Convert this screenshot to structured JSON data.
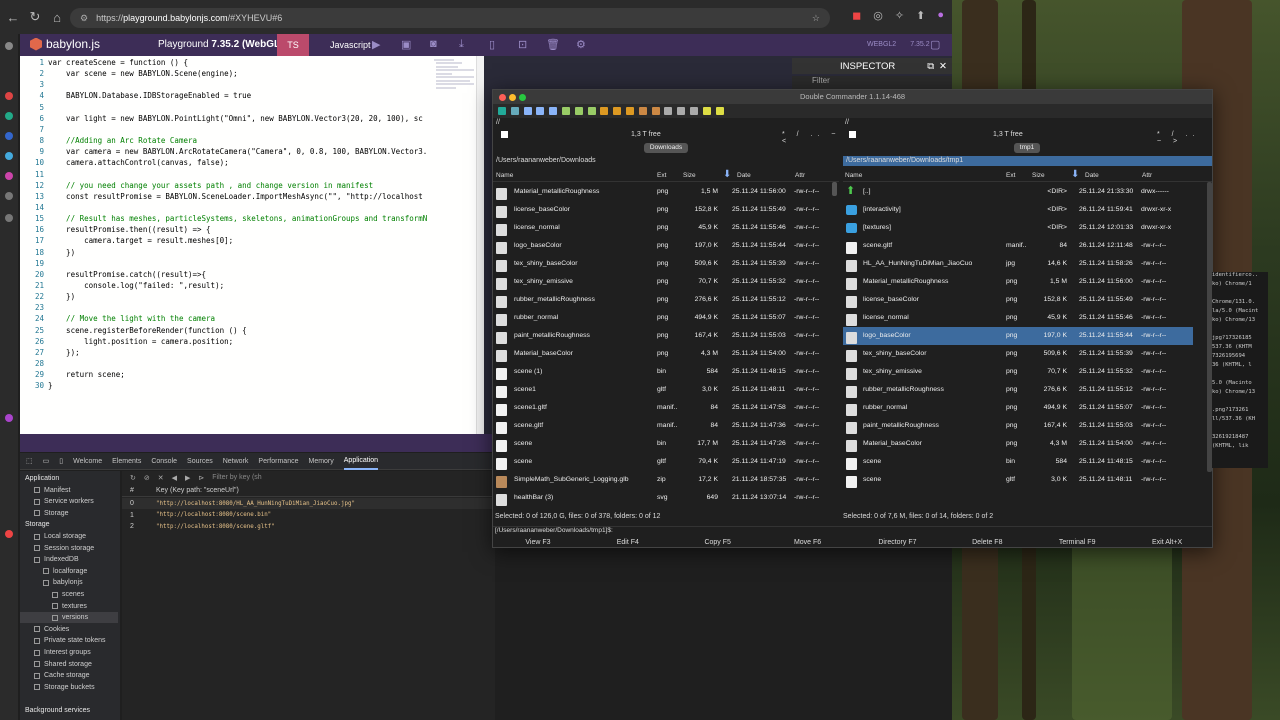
{
  "browser": {
    "url_host": "playground.babylonjs.com",
    "url_rest": "/#XYHEVU#6",
    "url_prefix": "https://"
  },
  "babylon": {
    "logo_text": "babylon.js",
    "playground_label": "Playground",
    "version_label": "7.35.2 (WebGL2)",
    "ts_label": "TS",
    "js_label": "Javascript",
    "webgl_label": "WEBGL2",
    "version_short": "7.35.2"
  },
  "code_lines": [
    {
      "n": "1",
      "t": "var createScene = function () {"
    },
    {
      "n": "2",
      "t": "    var scene = new BABYLON.Scene(engine);"
    },
    {
      "n": "3",
      "t": ""
    },
    {
      "n": "4",
      "t": "    BABYLON.Database.IDBStorageEnabled = true"
    },
    {
      "n": "5",
      "t": ""
    },
    {
      "n": "6",
      "t": "    var light = new BABYLON.PointLight(\"Omni\", new BABYLON.Vector3(20, 20, 100), sc"
    },
    {
      "n": "7",
      "t": ""
    },
    {
      "n": "8",
      "t": "    //Adding an Arc Rotate Camera"
    },
    {
      "n": "9",
      "t": "    var camera = new BABYLON.ArcRotateCamera(\"Camera\", 0, 0.8, 100, BABYLON.Vector3."
    },
    {
      "n": "10",
      "t": "    camera.attachControl(canvas, false);"
    },
    {
      "n": "11",
      "t": ""
    },
    {
      "n": "12",
      "t": "    // you need change your assets path , and change version in manifest"
    },
    {
      "n": "13",
      "t": "    const resultPromise = BABYLON.SceneLoader.ImportMeshAsync(\"\", \"http://localhost"
    },
    {
      "n": "14",
      "t": ""
    },
    {
      "n": "15",
      "t": "    // Result has meshes, particleSystems, skeletons, animationGroups and transformN"
    },
    {
      "n": "16",
      "t": "    resultPromise.then((result) => {"
    },
    {
      "n": "17",
      "t": "        camera.target = result.meshes[0];"
    },
    {
      "n": "18",
      "t": "    })"
    },
    {
      "n": "19",
      "t": ""
    },
    {
      "n": "20",
      "t": "    resultPromise.catch((result)=>{"
    },
    {
      "n": "21",
      "t": "        console.log(\"failed: \",result);"
    },
    {
      "n": "22",
      "t": "    })"
    },
    {
      "n": "23",
      "t": ""
    },
    {
      "n": "24",
      "t": "    // Move the light with the camera"
    },
    {
      "n": "25",
      "t": "    scene.registerBeforeRender(function () {"
    },
    {
      "n": "26",
      "t": "        light.position = camera.position;"
    },
    {
      "n": "27",
      "t": "    });"
    },
    {
      "n": "28",
      "t": ""
    },
    {
      "n": "29",
      "t": "    return scene;"
    },
    {
      "n": "30",
      "t": "}"
    }
  ],
  "inspector": {
    "title": "INSPECTOR",
    "filter": "Filter"
  },
  "devtools": {
    "tabs": [
      "Welcome",
      "Elements",
      "Console",
      "Sources",
      "Network",
      "Performance",
      "Memory",
      "Application"
    ],
    "active_tab": "Application",
    "filter_placeholder": "Filter by key (sh",
    "app_tree": [
      {
        "label": "Application",
        "indent": 0,
        "head": true
      },
      {
        "label": "Manifest",
        "indent": 1
      },
      {
        "label": "Service workers",
        "indent": 1
      },
      {
        "label": "Storage",
        "indent": 1
      },
      {
        "label": "Storage",
        "indent": 0,
        "head": true
      },
      {
        "label": "Local storage",
        "indent": 1
      },
      {
        "label": "Session storage",
        "indent": 1
      },
      {
        "label": "IndexedDB",
        "indent": 1
      },
      {
        "label": "localforage",
        "indent": 2
      },
      {
        "label": "babylonjs",
        "indent": 2
      },
      {
        "label": "scenes",
        "indent": 3
      },
      {
        "label": "textures",
        "indent": 3
      },
      {
        "label": "versions",
        "indent": 3,
        "selected": true
      },
      {
        "label": "Cookies",
        "indent": 1
      },
      {
        "label": "Private state tokens",
        "indent": 1
      },
      {
        "label": "Interest groups",
        "indent": 1
      },
      {
        "label": "Shared storage",
        "indent": 1
      },
      {
        "label": "Cache storage",
        "indent": 1
      },
      {
        "label": "Storage buckets",
        "indent": 1
      },
      {
        "label": "",
        "indent": 0
      },
      {
        "label": "Background services",
        "indent": 0,
        "head": true
      }
    ],
    "idb_columns": {
      "num": "#",
      "key": "Key (Key path: \"sceneUrl\")"
    },
    "idb_rows": [
      {
        "num": "0",
        "key": "\"http://localhost:8080/HL_AA_HunNingTuDiMian_JiaoCuo.jpg\""
      },
      {
        "num": "1",
        "key": "\"http://localhost:8080/scene.bin\""
      },
      {
        "num": "2",
        "key": "\"http://localhost:8080/scene.gltf\""
      }
    ]
  },
  "dc": {
    "title": "Double Commander 1.1.14-468",
    "left": {
      "drive": "//",
      "free": "1,3 T free",
      "nav": "* / .. ~ <",
      "tab": "Downloads",
      "path": "/Users/raananweber/Downloads",
      "status": "Selected: 0 of 126,0 G, files: 0 of 378, folders: 0 of 12",
      "files": [
        {
          "name": "Material_metallicRoughness",
          "ext": "png",
          "size": "1,5 M",
          "date": "25.11.24 11:56:00",
          "attr": "-rw-r--r--",
          "type": "img"
        },
        {
          "name": "license_baseColor",
          "ext": "png",
          "size": "152,8 K",
          "date": "25.11.24 11:55:49",
          "attr": "-rw-r--r--",
          "type": "img"
        },
        {
          "name": "license_normal",
          "ext": "png",
          "size": "45,9 K",
          "date": "25.11.24 11:55:46",
          "attr": "-rw-r--r--",
          "type": "img"
        },
        {
          "name": "logo_baseColor",
          "ext": "png",
          "size": "197,0 K",
          "date": "25.11.24 11:55:44",
          "attr": "-rw-r--r--",
          "type": "img"
        },
        {
          "name": "tex_shiny_baseColor",
          "ext": "png",
          "size": "509,6 K",
          "date": "25.11.24 11:55:39",
          "attr": "-rw-r--r--",
          "type": "img"
        },
        {
          "name": "tex_shiny_emissive",
          "ext": "png",
          "size": "70,7 K",
          "date": "25.11.24 11:55:32",
          "attr": "-rw-r--r--",
          "type": "img"
        },
        {
          "name": "rubber_metallicRoughness",
          "ext": "png",
          "size": "276,6 K",
          "date": "25.11.24 11:55:12",
          "attr": "-rw-r--r--",
          "type": "img"
        },
        {
          "name": "rubber_normal",
          "ext": "png",
          "size": "494,9 K",
          "date": "25.11.24 11:55:07",
          "attr": "-rw-r--r--",
          "type": "img"
        },
        {
          "name": "paint_metallicRoughness",
          "ext": "png",
          "size": "167,4 K",
          "date": "25.11.24 11:55:03",
          "attr": "-rw-r--r--",
          "type": "img"
        },
        {
          "name": "Material_baseColor",
          "ext": "png",
          "size": "4,3 M",
          "date": "25.11.24 11:54:00",
          "attr": "-rw-r--r--",
          "type": "img"
        },
        {
          "name": "scene (1)",
          "ext": "bin",
          "size": "584",
          "date": "25.11.24 11:48:15",
          "attr": "-rw-r--r--",
          "type": "file"
        },
        {
          "name": "scene1",
          "ext": "gltf",
          "size": "3,0 K",
          "date": "25.11.24 11:48:11",
          "attr": "-rw-r--r--",
          "type": "file"
        },
        {
          "name": "scene1.gltf",
          "ext": "manif..",
          "size": "84",
          "date": "25.11.24 11:47:58",
          "attr": "-rw-r--r--",
          "type": "file"
        },
        {
          "name": "scene.gltf",
          "ext": "manif..",
          "size": "84",
          "date": "25.11.24 11:47:36",
          "attr": "-rw-r--r--",
          "type": "file"
        },
        {
          "name": "scene",
          "ext": "bin",
          "size": "17,7 M",
          "date": "25.11.24 11:47:26",
          "attr": "-rw-r--r--",
          "type": "file"
        },
        {
          "name": "scene",
          "ext": "gltf",
          "size": "79,4 K",
          "date": "25.11.24 11:47:19",
          "attr": "-rw-r--r--",
          "type": "file"
        },
        {
          "name": "SimpleMath_SubGeneric_Logging.glb",
          "ext": "zip",
          "size": "17,2 K",
          "date": "21.11.24 18:57:35",
          "attr": "-rw-r--r--",
          "type": "zip"
        },
        {
          "name": "healthBar (3)",
          "ext": "svg",
          "size": "649",
          "date": "21.11.24 13:07:14",
          "attr": "-rw-r--r--",
          "type": "img"
        }
      ]
    },
    "right": {
      "drive": "//",
      "free": "1,3 T free",
      "nav": "* / .. ~ >",
      "tab": "tmp1",
      "path": "/Users/raananweber/Downloads/tmp1",
      "status": "Selected: 0 of 7,6 M, files: 0 of 14, folders: 0 of 2",
      "files": [
        {
          "name": "[..]",
          "ext": "",
          "size": "<DIR>",
          "date": "25.11.24 21:33:30",
          "attr": "drwx------",
          "type": "up"
        },
        {
          "name": "[interactivity]",
          "ext": "",
          "size": "<DIR>",
          "date": "26.11.24 11:59:41",
          "attr": "drwxr-xr-x",
          "type": "dir"
        },
        {
          "name": "[textures]",
          "ext": "",
          "size": "<DIR>",
          "date": "25.11.24 12:01:33",
          "attr": "drwxr-xr-x",
          "type": "dir"
        },
        {
          "name": "scene.gltf",
          "ext": "manif..",
          "size": "84",
          "date": "26.11.24 12:11:48",
          "attr": "-rw-r--r--",
          "type": "file"
        },
        {
          "name": "HL_AA_HunNingTuDiMian_JiaoCuo",
          "ext": "jpg",
          "size": "14,6 K",
          "date": "25.11.24 11:58:26",
          "attr": "-rw-r--r--",
          "type": "img"
        },
        {
          "name": "Material_metallicRoughness",
          "ext": "png",
          "size": "1,5 M",
          "date": "25.11.24 11:56:00",
          "attr": "-rw-r--r--",
          "type": "img"
        },
        {
          "name": "license_baseColor",
          "ext": "png",
          "size": "152,8 K",
          "date": "25.11.24 11:55:49",
          "attr": "-rw-r--r--",
          "type": "img"
        },
        {
          "name": "license_normal",
          "ext": "png",
          "size": "45,9 K",
          "date": "25.11.24 11:55:46",
          "attr": "-rw-r--r--",
          "type": "img"
        },
        {
          "name": "logo_baseColor",
          "ext": "png",
          "size": "197,0 K",
          "date": "25.11.24 11:55:44",
          "attr": "-rw-r--r--",
          "type": "img",
          "selected": true
        },
        {
          "name": "tex_shiny_baseColor",
          "ext": "png",
          "size": "509,6 K",
          "date": "25.11.24 11:55:39",
          "attr": "-rw-r--r--",
          "type": "img"
        },
        {
          "name": "tex_shiny_emissive",
          "ext": "png",
          "size": "70,7 K",
          "date": "25.11.24 11:55:32",
          "attr": "-rw-r--r--",
          "type": "img"
        },
        {
          "name": "rubber_metallicRoughness",
          "ext": "png",
          "size": "276,6 K",
          "date": "25.11.24 11:55:12",
          "attr": "-rw-r--r--",
          "type": "img"
        },
        {
          "name": "rubber_normal",
          "ext": "png",
          "size": "494,9 K",
          "date": "25.11.24 11:55:07",
          "attr": "-rw-r--r--",
          "type": "img"
        },
        {
          "name": "paint_metallicRoughness",
          "ext": "png",
          "size": "167,4 K",
          "date": "25.11.24 11:55:03",
          "attr": "-rw-r--r--",
          "type": "img"
        },
        {
          "name": "Material_baseColor",
          "ext": "png",
          "size": "4,3 M",
          "date": "25.11.24 11:54:00",
          "attr": "-rw-r--r--",
          "type": "img"
        },
        {
          "name": "scene",
          "ext": "bin",
          "size": "584",
          "date": "25.11.24 11:48:15",
          "attr": "-rw-r--r--",
          "type": "file"
        },
        {
          "name": "scene",
          "ext": "gltf",
          "size": "3,0 K",
          "date": "25.11.24 11:48:11",
          "attr": "-rw-r--r--",
          "type": "file"
        }
      ]
    },
    "columns": {
      "name": "Name",
      "ext": "Ext",
      "size": "Size",
      "date": "Date",
      "attr": "Attr"
    },
    "cmdline": "[/Users/raananweber/Downloads/tmp1]$:",
    "fkeys": [
      "View F3",
      "Edit F4",
      "Copy F5",
      "Move F6",
      "Directory F7",
      "Delete F8",
      "Terminal F9",
      "Exit Alt+X"
    ]
  },
  "terminal_lines": [
    "identifierco..",
    "ko) Chrome/1",
    "",
    "Chrome/131.0.",
    "la/5.0 (Macint",
    "ko) Chrome/13",
    "",
    "jpg?17326185",
    "537.36 (KHTM",
    "7326195694",
    "36 (KHTML, l",
    "",
    "5.0 (Macinto",
    "ko) Chrome/13",
    "",
    ".png?173261",
    "ll/537.36 (KH",
    "",
    "32619218487",
    "(KHTML, lik"
  ]
}
